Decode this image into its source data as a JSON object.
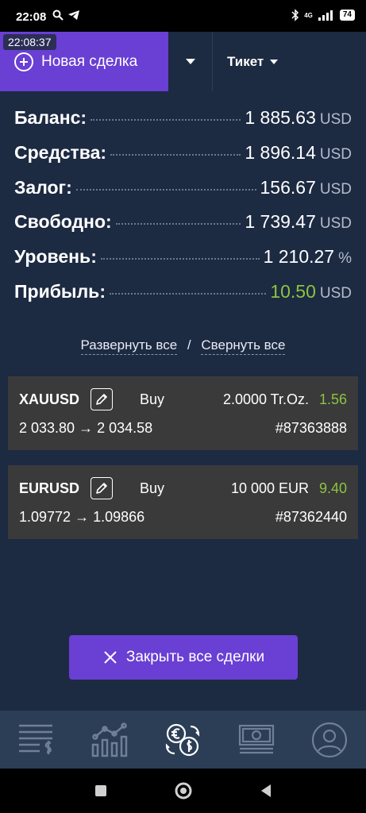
{
  "status_bar": {
    "time": "22:08",
    "network": "4G",
    "battery": "74"
  },
  "clock_badge": "22:08:37",
  "toolbar": {
    "new_deal_label": "Новая сделка",
    "ticket_label": "Тикет"
  },
  "summary": [
    {
      "label": "Баланс:",
      "value": "1 885.63",
      "unit": "USD",
      "highlight": false
    },
    {
      "label": "Средства:",
      "value": "1 896.14",
      "unit": "USD",
      "highlight": false
    },
    {
      "label": "Залог:",
      "value": "156.67",
      "unit": "USD",
      "highlight": false
    },
    {
      "label": "Свободно:",
      "value": "1 739.47",
      "unit": "USD",
      "highlight": false
    },
    {
      "label": "Уровень:",
      "value": "1 210.27",
      "unit": "%",
      "highlight": false
    },
    {
      "label": "Прибыль:",
      "value": "10.50",
      "unit": "USD",
      "highlight": true
    }
  ],
  "links": {
    "expand_all": "Развернуть все",
    "separator": "/",
    "collapse_all": "Свернуть все"
  },
  "trades": [
    {
      "symbol": "XAUUSD",
      "side": "Buy",
      "volume": "2.0000 Tr.Oz.",
      "profit": "1.56",
      "prices": "2 033.80 → 2 034.58",
      "ticket": "#87363888"
    },
    {
      "symbol": "EURUSD",
      "side": "Buy",
      "volume": "10 000 EUR",
      "profit": "9.40",
      "prices": "1.09772 → 1.09866",
      "ticket": "#87362440"
    }
  ],
  "close_all_label": "Закрыть все сделки",
  "colors": {
    "accent": "#6a3fd4",
    "background": "#1c2a42",
    "profit": "#8cc43f",
    "card": "#3a3a3a",
    "nav": "#2b3e55"
  },
  "bottom_nav": [
    {
      "icon": "statement-icon"
    },
    {
      "icon": "chart-icon"
    },
    {
      "icon": "exchange-icon"
    },
    {
      "icon": "money-icon"
    },
    {
      "icon": "profile-icon"
    }
  ]
}
